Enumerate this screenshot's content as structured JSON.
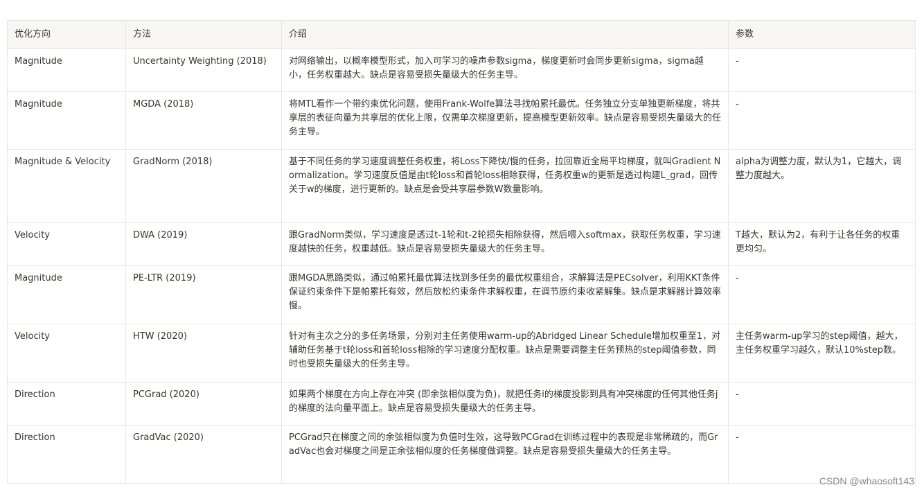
{
  "table": {
    "headers": [
      "优化方向",
      "方法",
      "介绍",
      "参数"
    ],
    "rows": [
      {
        "direction": "Magnitude",
        "method": "Uncertainty Weighting (2018)",
        "intro": "对网络输出，以概率模型形式，加入可学习的噪声参数sigma，梯度更新时会同步更新sigma，sigma越小，任务权重越大。缺点是容易受损失量级大的任务主导。",
        "params": "-"
      },
      {
        "direction": "Magnitude",
        "method": "MGDA (2018)",
        "intro": "将MTL看作一个带约束优化问题，使用Frank-Wolfe算法寻找帕累托最优。任务独立分支单独更新梯度，将共享层的表征向量为共享层的优化上限，仅需单次梯度更新，提高模型更新效率。缺点是容易受损失量级大的任务主导。",
        "params": "-"
      },
      {
        "direction": "Magnitude & Velocity",
        "method": "GradNorm (2018)",
        "intro": "基于不同任务的学习速度调整任务权重，将Loss下降快/慢的任务，拉回靠近全局平均梯度，就叫Gradient Normalization。学习速度反值是由t轮loss和首轮loss相除获得，任务权重w的更新是透过构建L_grad，回传关于w的梯度，进行更新的。缺点是会受共享层参数W数量影响。",
        "params": "alpha为调整力度，默认为1，它越大，调整力度越大。"
      },
      {
        "direction": "Velocity",
        "method": "DWA (2019)",
        "intro": "跟GradNorm类似，学习速度是透过t-1轮和t-2轮损失相除获得，然后喂入softmax，获取任务权重，学习速度越快的任务，权重越低。缺点是容易受损失量级大的任务主导。",
        "params": "T越大，默认为2，有利于让各任务的权重更均匀。"
      },
      {
        "direction": "Magnitude",
        "method": "PE-LTR (2019)",
        "intro": "跟MGDA思路类似，通过帕累托最优算法找到多任务的最优权重组合，求解算法是PECsolver，利用KKT条件保证约束条件下是帕累托有效，然后放松约束条件求解权重，在调节原约束收紧解集。缺点是求解器计算效率慢。",
        "params": "-"
      },
      {
        "direction": "Velocity",
        "method": "HTW (2020)",
        "intro": "针对有主次之分的多任务场景，分别对主任务使用warm-up的Abridged Linear Schedule增加权重至1，对辅助任务基于t轮loss和首轮loss相除的学习速度分配权重。缺点是需要调整主任务预热的step阈值参数，同时也受损失量级大的任务主导。",
        "params": "主任务warm-up学习的step阈值，越大，主任务权重学习越久，默认10%step数。"
      },
      {
        "direction": "Direction",
        "method": "PCGrad (2020)",
        "intro": "如果两个梯度在方向上存在冲突 (即余弦相似度为负)，就把任务i的梯度投影到具有冲突梯度的任何其他任务j的梯度的法向量平面上。缺点是容易受损失量级大的任务主导。",
        "params": "-"
      },
      {
        "direction": "Direction",
        "method": "GradVac (2020)",
        "intro": "PCGrad只在梯度之间的余弦相似度为负值时生效，这导致PCGrad在训练过程中的表现是非常稀疏的，而GradVac也会对梯度之间是正余弦相似度的任务梯度做调整。缺点是容易受损失量级大的任务主导。",
        "params": "-"
      }
    ]
  },
  "watermark": "CSDN @whaosoft143"
}
